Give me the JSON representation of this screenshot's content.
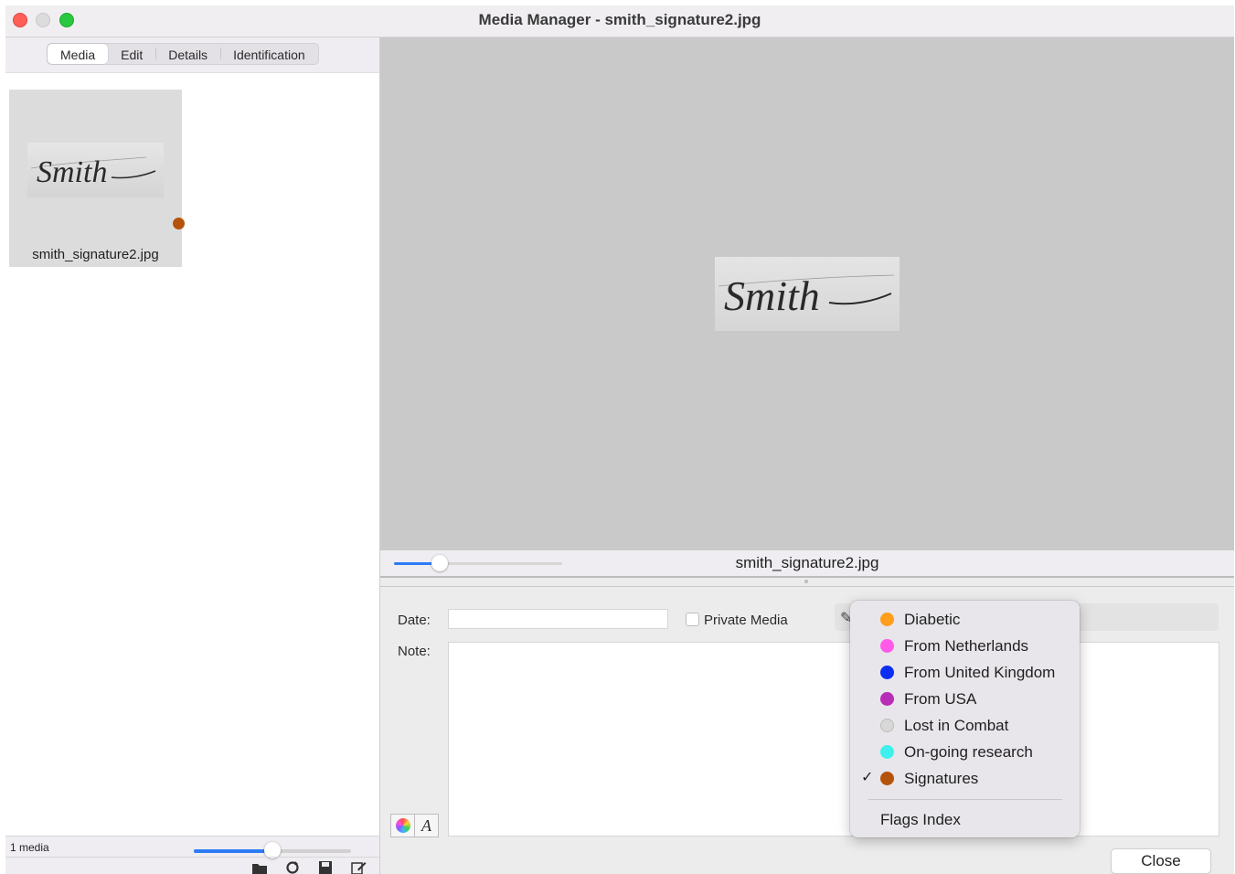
{
  "window": {
    "title": "Media Manager - smith_signature2.jpg"
  },
  "tabs": [
    "Media",
    "Edit",
    "Details",
    "Identification"
  ],
  "thumbnail": {
    "filename": "smith_signature2.jpg",
    "flag_color": "#b5530b",
    "image_text": "Smith"
  },
  "left_status": {
    "count": "1 media",
    "zoom_fraction": 0.5
  },
  "preview": {
    "filename": "smith_signature2.jpg",
    "image_text": "Smith",
    "zoom_fraction": 0.27
  },
  "form": {
    "date_label": "Date:",
    "date_value": "",
    "private_label": "Private Media",
    "private_checked": false,
    "note_label": "Note:",
    "note_value": "",
    "font_button": "A",
    "close_label": "Close"
  },
  "flag_menu": {
    "items": [
      {
        "label": "Diabetic",
        "color": "#ff9d1c",
        "checked": false
      },
      {
        "label": "From Netherlands",
        "color": "#ff5be8",
        "checked": false
      },
      {
        "label": "From United Kingdom",
        "color": "#0c2ef0",
        "checked": false
      },
      {
        "label": "From USA",
        "color": "#b72db6",
        "checked": false
      },
      {
        "label": "Lost in Combat",
        "color": "#d8d8d8",
        "checked": false
      },
      {
        "label": "On-going research",
        "color": "#3ef1ee",
        "checked": false
      },
      {
        "label": "Signatures",
        "color": "#b5530b",
        "checked": true
      }
    ],
    "check_glyph": "✓",
    "footer": "Flags Index"
  },
  "icons": {
    "folder": "folder-icon",
    "refresh": "refresh-icon",
    "save": "save-icon",
    "edit": "edit-icon",
    "color_wheel": "color-wheel-icon",
    "pencil": "pencil-icon"
  }
}
